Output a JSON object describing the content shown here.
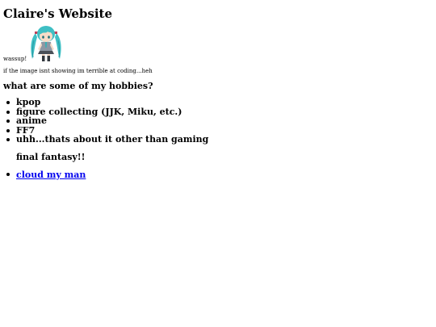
{
  "page": {
    "title": "Claire's Website",
    "greeting": "wassup!",
    "image_note": "if the image isnt showing im terrible at coding...heh"
  },
  "image": {
    "icon_name": "miku-figure-image",
    "colors": {
      "hair": "#3fbfc4",
      "hair_shadow": "#2a9aa3",
      "skin": "#f6dcc8",
      "outfit": "#8d97a3",
      "tie": "#2fb3b8",
      "boots": "#33383e"
    }
  },
  "hobbies": {
    "heading": "what are some of my hobbies?",
    "items": [
      {
        "label": "kpop"
      },
      {
        "label": "figure collecting (JJK, Miku, etc.)"
      },
      {
        "label": "anime"
      },
      {
        "label": "FF7"
      },
      {
        "label": "uhh...thats about it other than gaming"
      }
    ],
    "after_note": "final fantasy!!"
  },
  "links": {
    "items": [
      {
        "label": "cloud my man"
      }
    ],
    "link_color": "#0000ee"
  }
}
